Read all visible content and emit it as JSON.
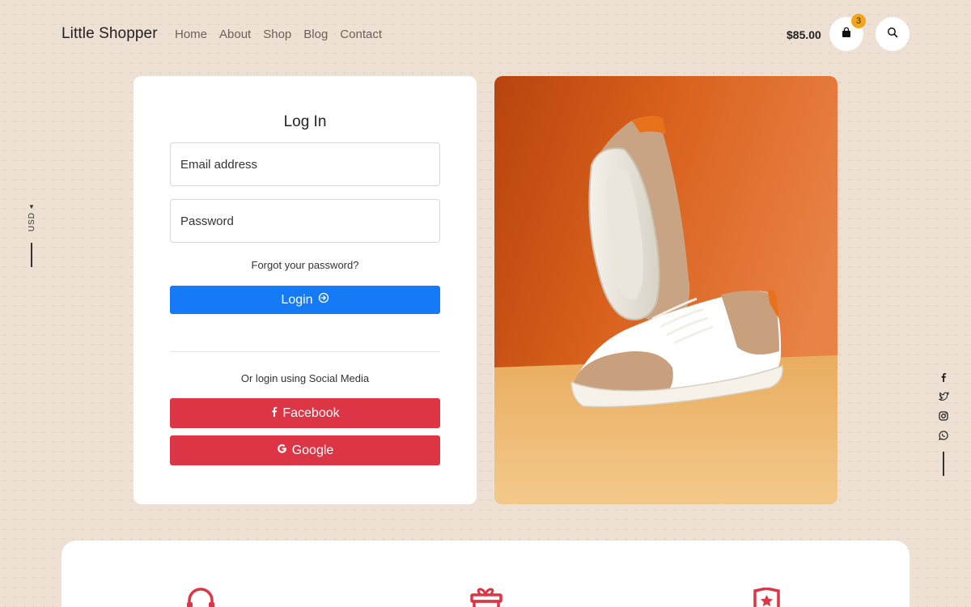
{
  "header": {
    "brand": "Little Shopper",
    "nav": [
      "Home",
      "About",
      "Shop",
      "Blog",
      "Contact"
    ],
    "cart_total": "$85.00",
    "cart_count": "3",
    "icons": {
      "cart": "shopping-bag-icon",
      "search": "search-icon"
    }
  },
  "currency": {
    "label": "USD",
    "icon": "caret-down-icon"
  },
  "social_rail": [
    "facebook-icon",
    "twitter-icon",
    "instagram-icon",
    "whatsapp-icon"
  ],
  "login": {
    "title": "Log In",
    "email_placeholder": "Email address",
    "password_placeholder": "Password",
    "forgot": "Forgot your password?",
    "login_button": "Login",
    "social_text": "Or login using Social Media",
    "facebook_button": "Facebook",
    "google_button": "Google"
  },
  "colors": {
    "background": "#efe0d4",
    "primary": "#157af6",
    "danger": "#dc3545",
    "badge": "#f4a51c",
    "feature_icon": "#dc3545"
  },
  "hero": {
    "description": "shoes-photo"
  },
  "features": {
    "icons": [
      "headset-icon",
      "gift-icon",
      "shield-star-icon"
    ]
  }
}
